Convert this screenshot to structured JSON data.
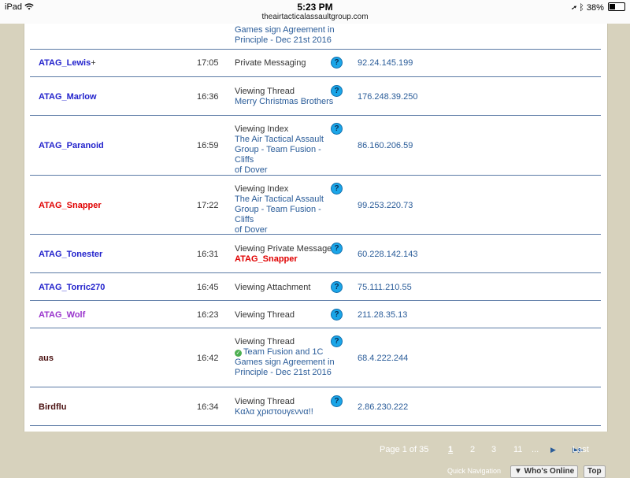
{
  "statusbar": {
    "device": "iPad",
    "wifi_icon": "wifi-icon",
    "time": "5:23 PM",
    "url": "theairtacticalassaultgroup.com",
    "battery": "38%",
    "battery_level": 0.38
  },
  "top_fragment": {
    "location_line1": "Games sign Agreement in",
    "location_line2": "Principle - Dec 21st 2016"
  },
  "rows": [
    {
      "user": "ATAG_Lewis",
      "user_suffix": "+",
      "time": "17:05",
      "activity": "Private Messaging",
      "detail": "",
      "ip": "92.24.145.199"
    },
    {
      "user": "ATAG_Marlow",
      "time": "16:36",
      "activity": "Viewing Thread",
      "detail": "Merry Christmas Brothers",
      "ip": "176.248.39.250"
    },
    {
      "user": "ATAG_Paranoid",
      "time": "16:59",
      "activity": "Viewing Index",
      "detail_l1": "The Air Tactical Assault",
      "detail_l2": "Group - Team Fusion - Cliffs",
      "detail_l3": "of Dover",
      "ip": "86.160.206.59"
    },
    {
      "user": "ATAG_Snapper",
      "time": "17:22",
      "activity": "Viewing Index",
      "detail_l1": "The Air Tactical Assault",
      "detail_l2": "Group - Team Fusion - Cliffs",
      "detail_l3": "of Dover",
      "ip": "99.253.220.73"
    },
    {
      "user": "ATAG_Tonester",
      "time": "16:31",
      "activity": "Viewing Private Message",
      "detail": "ATAG_Snapper",
      "ip": "60.228.142.143"
    },
    {
      "user": "ATAG_Torric270",
      "time": "16:45",
      "activity": "Viewing Attachment",
      "ip": "75.111.210.55"
    },
    {
      "user": "ATAG_Wolf",
      "time": "16:23",
      "activity": "Viewing Thread",
      "ip": "211.28.35.13"
    },
    {
      "user": "aus",
      "time": "16:42",
      "activity": "Viewing Thread",
      "detail_l1": "Team Fusion and 1C",
      "detail_l2": "Games sign Agreement in",
      "detail_l3": "Principle - Dec 21st 2016",
      "ip": "68.4.222.244"
    },
    {
      "user": "Birdflu",
      "time": "16:34",
      "activity": "Viewing Thread",
      "detail": "Καλα χριστουγεννα!!",
      "ip": "2.86.230.222"
    }
  ],
  "pager": {
    "label": "Page 1 of 35",
    "current": "1",
    "p2": "2",
    "p3": "3",
    "p11": "11",
    "dots": "...",
    "next": "▶",
    "last": "Last",
    "last_icon": "▶▶"
  },
  "bottom": {
    "quick_nav": "Quick Navigation",
    "whos_online": "▼ Who's Online",
    "top": "Top"
  },
  "info_icon": "?",
  "check_icon": "✓"
}
